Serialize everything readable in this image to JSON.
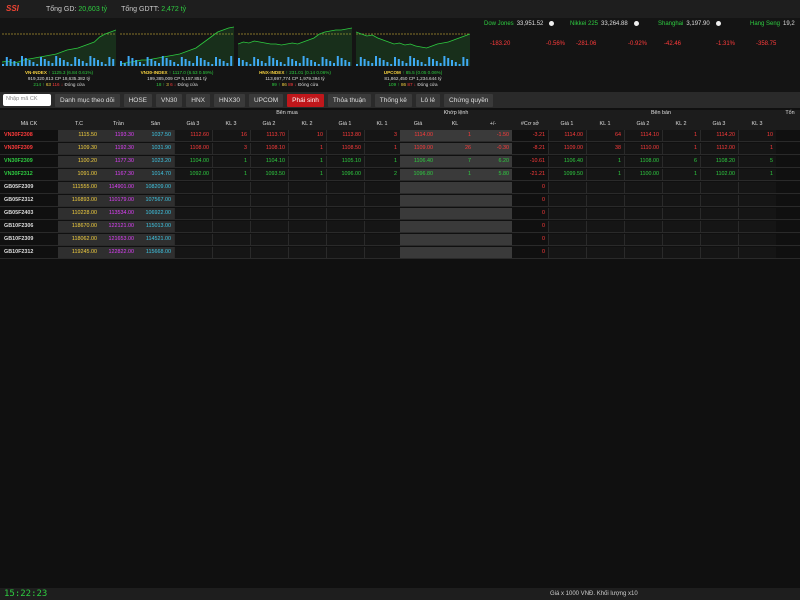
{
  "topbar": {
    "logo": "SSI",
    "total_gd_label": "Tổng GD:",
    "total_gd_value": "20,603 tỷ",
    "total_gdtt_label": "Tổng GDTT:",
    "total_gdtt_value": "2,472 tỷ"
  },
  "indices": [
    {
      "name": "VN-INDEX",
      "line1": "↑ 1125.3 (6.84 0.61%)",
      "line2": "919,320,813 CP 18,635.382 tỷ",
      "up": "214 ↑",
      "ref": "63",
      "down": "116 ↓",
      "status": "Đóng cửa"
    },
    {
      "name": "VN30-INDEX",
      "line1": "↑ 1117.0 (6.53 0.59%)",
      "line2": "199,385,009 CP 5,157.851 tỷ",
      "up": "18 ↑",
      "ref": "3",
      "down": "6 ↓",
      "status": "Đóng cửa"
    },
    {
      "name": "HNX-INDEX",
      "line1": "↑ 231.01 (0.14 0.06%)",
      "line2": "113,697,774 CP 1,979.394 tỷ",
      "up": "99 ↑",
      "ref": "86",
      "down": "89 ↓",
      "status": "Đóng cửa"
    },
    {
      "name": "UPCOM",
      "line1": "↑ 85.5 (0.05 0.06%)",
      "line2": "81,862,450 CP 1,234.644 tỷ",
      "up": "109 ↑",
      "ref": "86",
      "down": "87 ↓",
      "status": "Đóng cửa"
    }
  ],
  "world": [
    {
      "name": "Dow Jones",
      "point": "33,951.52",
      "change": "-183.20",
      "pct": "-0.56%"
    },
    {
      "name": "Nikkei 225",
      "point": "33,264.88",
      "change": "-281.06",
      "pct": "-0.92%"
    },
    {
      "name": "Shanghai",
      "point": "3,197.90",
      "change": "-42.46",
      "pct": "-1.31%"
    },
    {
      "name": "Hang Seng",
      "point": "19,2",
      "change": "-358.75",
      "pct": ""
    }
  ],
  "toolbar": {
    "search_placeholder": "Nhập mã CK",
    "buttons": [
      "Danh mục theo dõi",
      "HOSE",
      "VN30",
      "HNX",
      "HNX30",
      "UPCOM",
      "Phái sinh",
      "Thỏa thuận",
      "Thống kê",
      "Lô lẻ",
      "Chứng quyền"
    ],
    "active": "Phái sinh"
  },
  "table": {
    "group_headers": {
      "bid": "Bên mua",
      "match": "Khớp lệnh",
      "ask": "Bên bán",
      "total": "Tổn"
    },
    "col_headers": [
      "Mã CK",
      "T.C",
      "Trần",
      "Sàn",
      "Giá 3",
      "KL 3",
      "Giá 2",
      "KL 2",
      "Giá 1",
      "KL 1",
      "Giá",
      "KL",
      "+/-",
      "#Cơ sở",
      "Giá 1",
      "KL 1",
      "Giá 2",
      "KL 2",
      "Giá 3",
      "KL 3"
    ],
    "rows": [
      {
        "sym": "VN30F2308",
        "color": "r",
        "tc": "1115.50",
        "tran": "1193.30",
        "san": "1037.50",
        "b3": "1112.60",
        "bk3": "16",
        "b2": "1113.70",
        "bk2": "10",
        "b1": "1113.80",
        "bk1": "3",
        "p": "1114.00",
        "kl": "1",
        "d": "-1.50",
        "bs": "-3.21",
        "a1": "1114.00",
        "ak1": "64",
        "a2": "1114.10",
        "ak2": "1",
        "a3": "1114.20",
        "ak3": "10"
      },
      {
        "sym": "VN30F2309",
        "color": "r",
        "tc": "1109.30",
        "tran": "1192.30",
        "san": "1031.90",
        "b3": "1108.00",
        "bk3": "3",
        "b2": "1108.10",
        "bk2": "1",
        "b1": "1108.50",
        "bk1": "1",
        "p": "1109.00",
        "kl": "26",
        "d": "-0.30",
        "bs": "-8.21",
        "a1": "1109.00",
        "ak1": "38",
        "a2": "1110.00",
        "ak2": "1",
        "a3": "1112.00",
        "ak3": "1"
      },
      {
        "sym": "VN30F2309",
        "color": "g",
        "tc": "1100.20",
        "tran": "1177.30",
        "san": "1023.20",
        "b3": "1104.00",
        "bk3": "1",
        "b2": "1104.10",
        "bk2": "1",
        "b1": "1105.10",
        "bk1": "1",
        "p": "1106.40",
        "kl": "7",
        "d": "6.20",
        "bs": "-10.61",
        "a1": "1106.40",
        "ak1": "1",
        "a2": "1108.00",
        "ak2": "6",
        "a3": "1108.20",
        "ak3": "5"
      },
      {
        "sym": "VN30F2312",
        "color": "g",
        "tc": "1091.00",
        "tran": "1167.30",
        "san": "1014.70",
        "b3": "1092.00",
        "bk3": "1",
        "b2": "1093.50",
        "bk2": "1",
        "b1": "1096.00",
        "bk1": "2",
        "p": "1096.80",
        "kl": "1",
        "d": "5.80",
        "bs": "-21.21",
        "a1": "1099.50",
        "ak1": "1",
        "a2": "1100.00",
        "ak2": "1",
        "a3": "1102.00",
        "ak3": "1"
      },
      {
        "sym": "GB05F2309",
        "color": "w",
        "tc": "111555.00",
        "tran": "114901.00",
        "san": "108209.00",
        "bs": "0"
      },
      {
        "sym": "GB05F2312",
        "color": "w",
        "tc": "116893.00",
        "tran": "110179.00",
        "san": "107567.00",
        "bs": "0"
      },
      {
        "sym": "GB05F2403",
        "color": "w",
        "tc": "110228.00",
        "tran": "113534.00",
        "san": "106922.00",
        "bs": "0"
      },
      {
        "sym": "GB10F2306",
        "color": "w",
        "tc": "118670.00",
        "tran": "122121.00",
        "san": "115013.00",
        "bs": "0"
      },
      {
        "sym": "GB10F2309",
        "color": "w",
        "tc": "118062.00",
        "tran": "121653.00",
        "san": "114521.00",
        "bs": "0"
      },
      {
        "sym": "GB10F2312",
        "color": "w",
        "tc": "119245.00",
        "tran": "122822.00",
        "san": "115668.00",
        "bs": "0"
      }
    ]
  },
  "footer": {
    "clock": "15:22:23",
    "note": "Giá x 1000 VNĐ. Khối lượng x10"
  }
}
